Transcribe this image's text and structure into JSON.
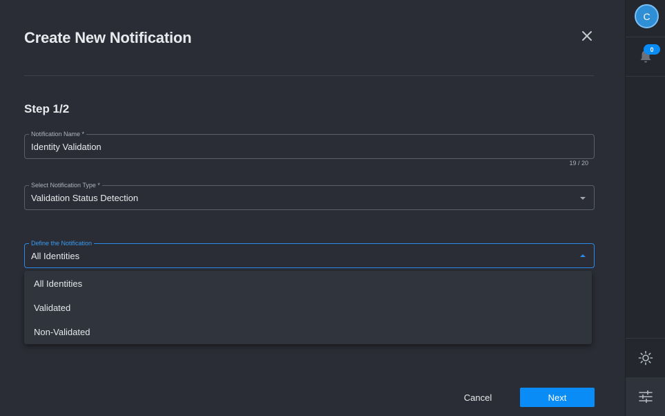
{
  "dialog": {
    "title": "Create New Notification",
    "step": "Step 1/2",
    "fields": {
      "name": {
        "label": "Notification Name *",
        "value": "Identity Validation",
        "counter": "19 / 20"
      },
      "type": {
        "label": "Select Notification Type *",
        "value": "Validation Status Detection"
      },
      "define": {
        "label": "Define the Notification",
        "value": "All Identities",
        "options": [
          "All Identities",
          "Validated",
          "Non-Validated"
        ]
      }
    },
    "buttons": {
      "cancel": "Cancel",
      "next": "Next"
    }
  },
  "rail": {
    "avatar_initial": "C",
    "notification_count": "0",
    "icons": [
      "bell-icon",
      "sun-icon",
      "tune-icon"
    ]
  },
  "colors": {
    "background": "#2a2d35",
    "rail": "#24272e",
    "accent": "#0a8cf7",
    "focus_border": "#2b8de9",
    "menu": "#30343c"
  }
}
